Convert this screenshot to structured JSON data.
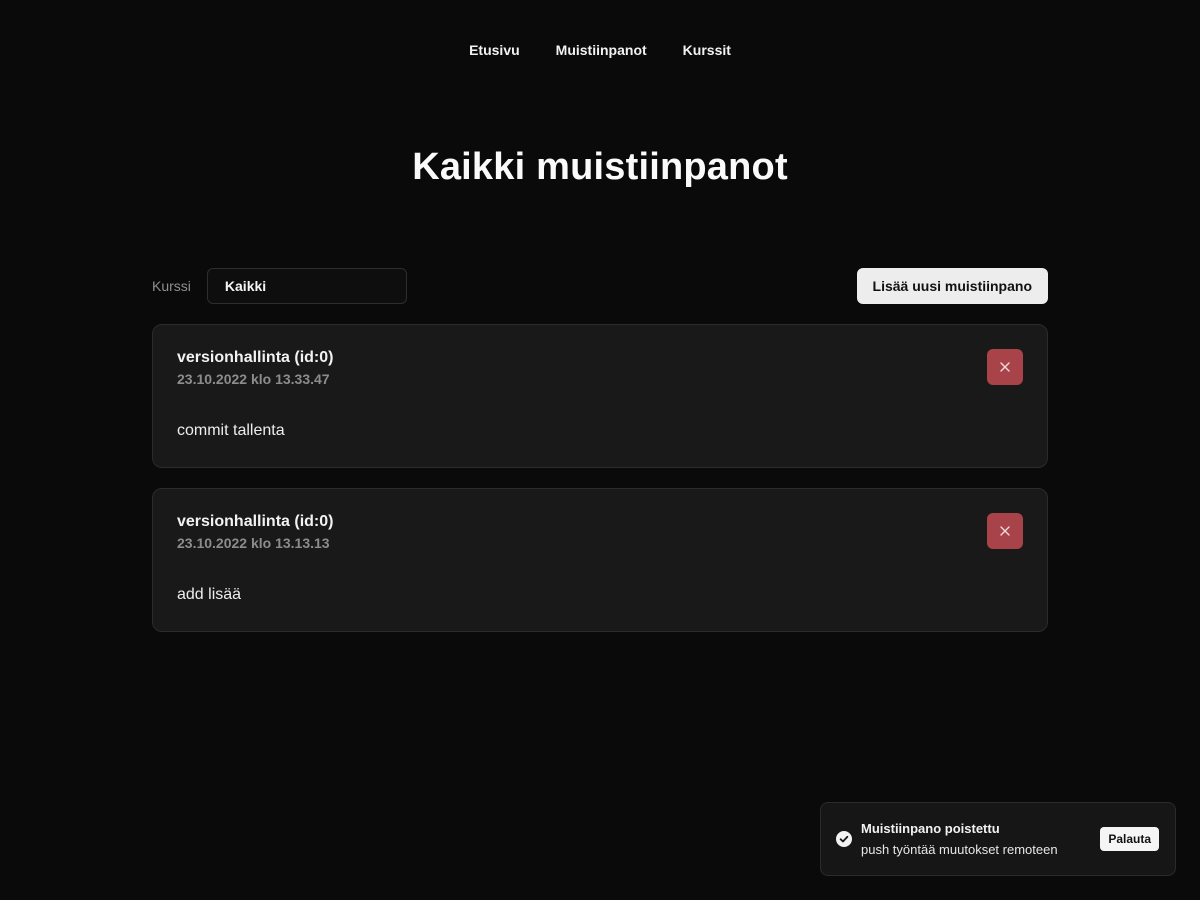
{
  "nav": {
    "items": [
      {
        "label": "Etusivu"
      },
      {
        "label": "Muistiinpanot"
      },
      {
        "label": "Kurssit"
      }
    ]
  },
  "page": {
    "title": "Kaikki muistiinpanot"
  },
  "filter": {
    "label": "Kurssi",
    "selected": "Kaikki"
  },
  "toolbar": {
    "add_label": "Lisää uusi muistiinpano"
  },
  "notes": [
    {
      "title": "versionhallinta (id:0)",
      "date": "23.10.2022 klo 13.33.47",
      "body": "commit tallenta",
      "delete_icon": "close-icon"
    },
    {
      "title": "versionhallinta (id:0)",
      "date": "23.10.2022 klo 13.13.13",
      "body": "add lisää",
      "delete_icon": "close-icon"
    }
  ],
  "toast": {
    "icon": "check-circle-icon",
    "title": "Muistiinpano poistettu",
    "description": "push työntää muutokset remoteen",
    "action_label": "Palauta"
  },
  "colors": {
    "background": "#0a0a0a",
    "card": "#191919",
    "danger": "#a8434a",
    "primary_button": "#ededed"
  }
}
